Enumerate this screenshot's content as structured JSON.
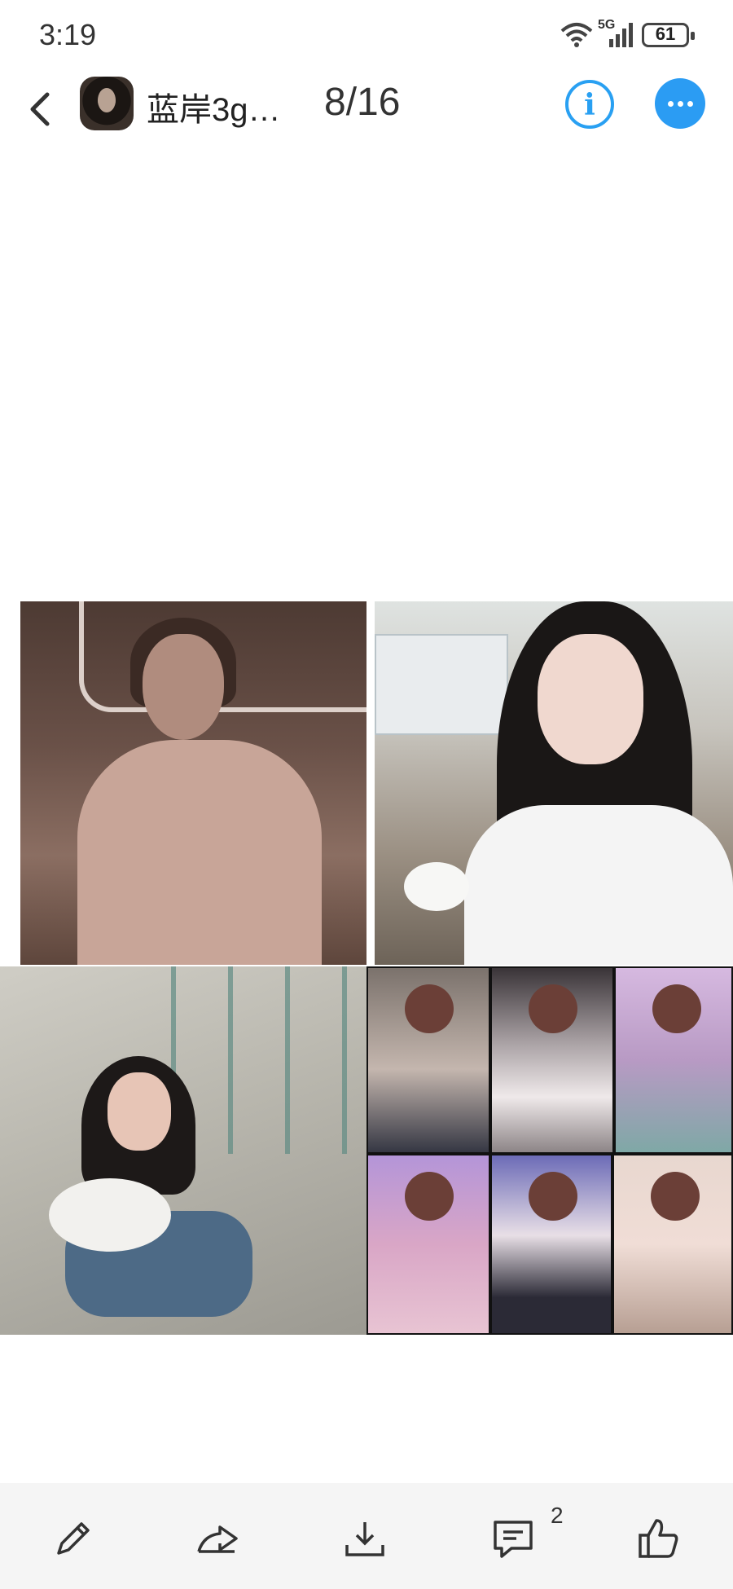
{
  "status_bar": {
    "time": "3:19",
    "network": "5G",
    "battery": "61",
    "icons": [
      "wifi-icon",
      "signal-icon",
      "battery-icon"
    ]
  },
  "header": {
    "title": "蓝岸3g…",
    "counter": "8/16",
    "icons": [
      "back-icon",
      "info-icon",
      "more-icon"
    ]
  },
  "colors": {
    "accent": "#2b9cf3",
    "bottom_bar": "#f5f5f5"
  },
  "bottom_bar": {
    "comment_count": "2",
    "icons": [
      "edit-icon",
      "share-icon",
      "download-icon",
      "comment-icon",
      "like-icon"
    ]
  }
}
